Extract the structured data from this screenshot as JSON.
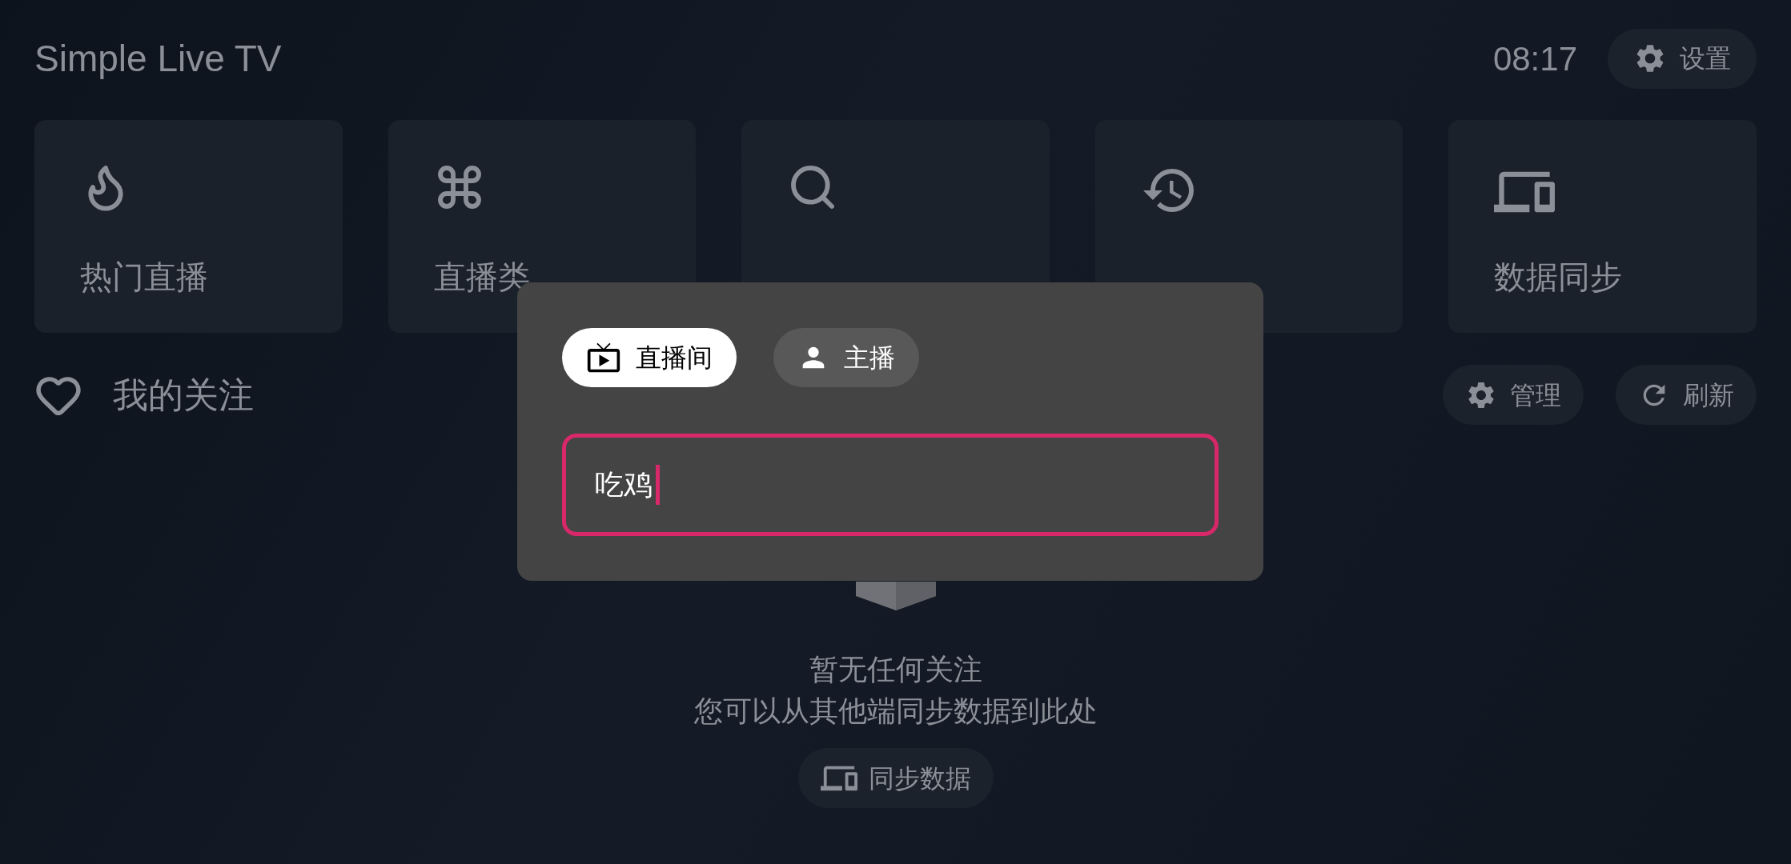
{
  "app_title": "Simple Live TV",
  "clock": "08:17",
  "settings_button": {
    "label": "设置"
  },
  "tiles": [
    {
      "label": "热门直播",
      "kind": "hot"
    },
    {
      "label": "直播类",
      "kind": "category"
    },
    {
      "kind": "search"
    },
    {
      "kind": "history"
    },
    {
      "label": "数据同步",
      "kind": "sync"
    }
  ],
  "following": {
    "title": "我的关注",
    "buttons": [
      {
        "label": "管理",
        "kind": "manage"
      },
      {
        "label": "刷新",
        "kind": "refresh"
      }
    ]
  },
  "empty_state": {
    "title": "暂无任何关注",
    "message": "您可以从其他端同步数据到此处",
    "button": "同步数据"
  },
  "search_dialog": {
    "tabs": [
      {
        "label": "直播间",
        "selected": true,
        "kind": "room"
      },
      {
        "label": "主播",
        "selected": false,
        "kind": "streamer"
      }
    ],
    "query": "吃鸡",
    "focused": true
  }
}
